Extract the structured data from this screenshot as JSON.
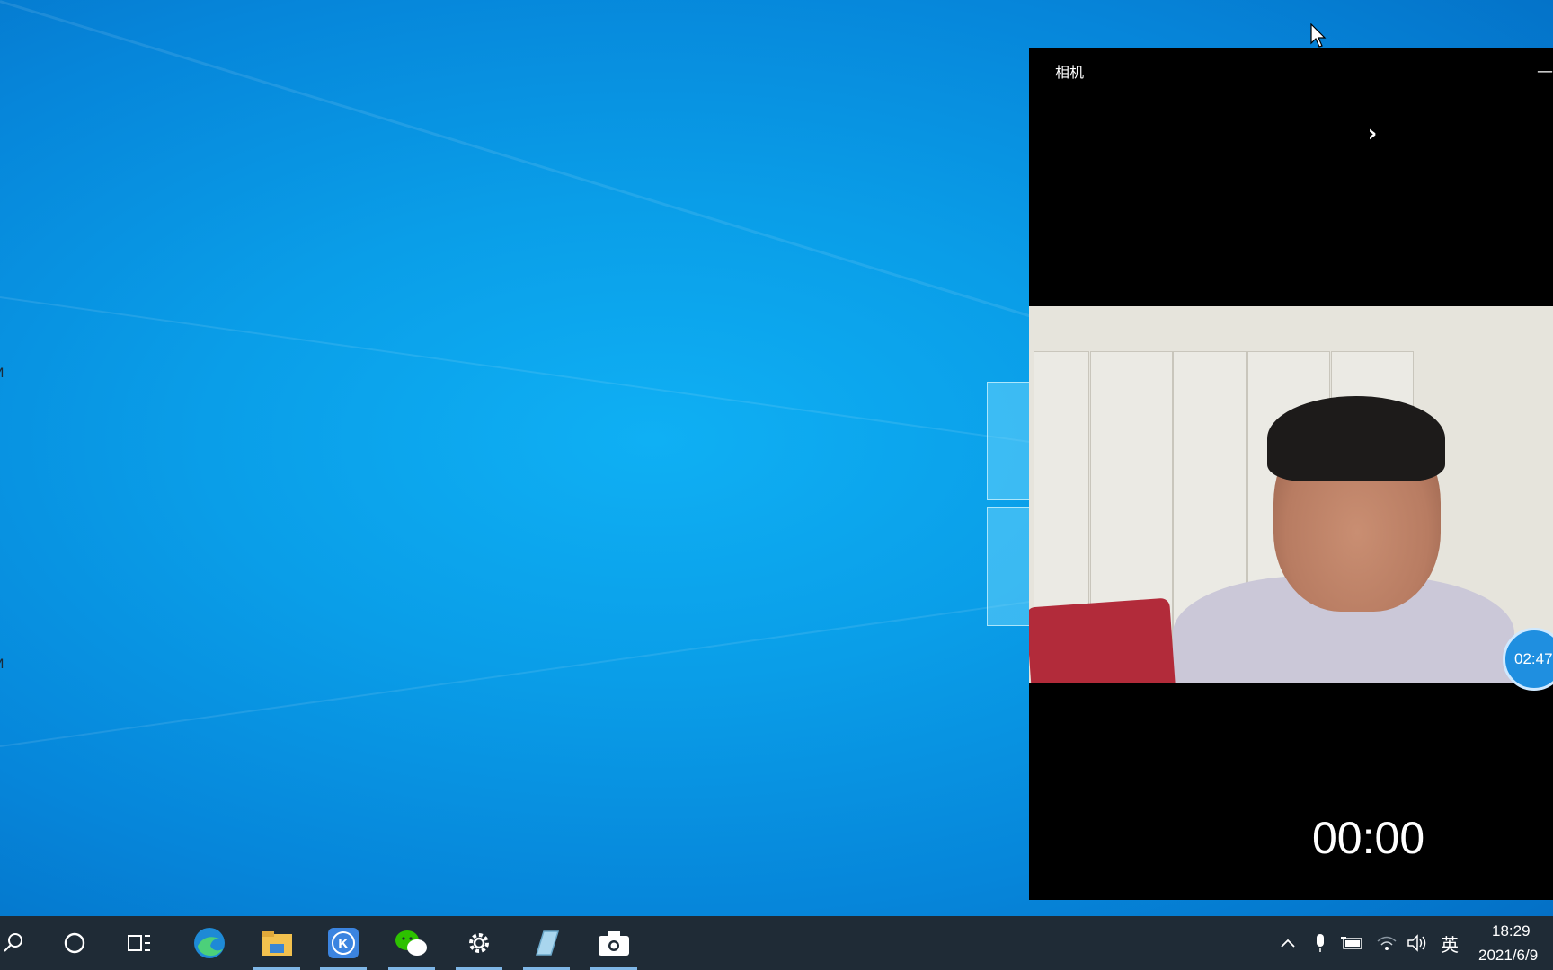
{
  "camera_window": {
    "title": "相机",
    "minimize_glyph": "—",
    "chevron_glyph": "›",
    "timer_badge": "02:47",
    "recording_time": "00:00"
  },
  "desktop": {
    "partial_label_1": "И",
    "partial_label_2": "И"
  },
  "taskbar": {
    "apps": [
      {
        "name": "search-icon"
      },
      {
        "name": "cortana-icon"
      },
      {
        "name": "task-view-icon"
      },
      {
        "name": "edge-icon"
      },
      {
        "name": "file-explorer-icon"
      },
      {
        "name": "k-app-icon"
      },
      {
        "name": "wechat-icon"
      },
      {
        "name": "settings-icon"
      },
      {
        "name": "notepad-icon"
      },
      {
        "name": "camera-icon"
      }
    ],
    "tray": {
      "ime": "英",
      "time": "18:29",
      "date": "2021/6/9"
    }
  },
  "colors": {
    "taskbar_bg": "#1f2b36",
    "accent_underline": "#7eb6e6",
    "badge_blue": "#1f8fe0"
  }
}
